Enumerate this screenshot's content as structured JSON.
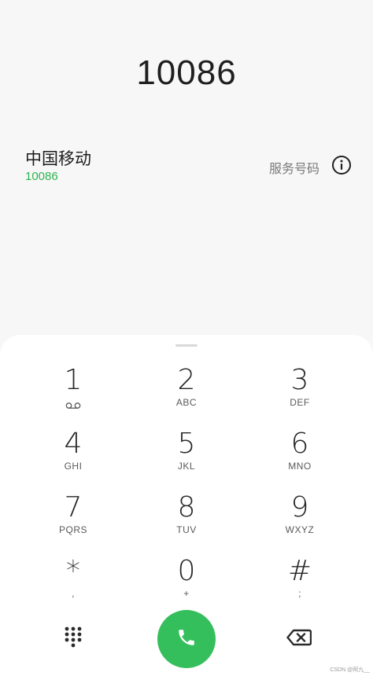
{
  "dialer": {
    "dialed_number": "10086"
  },
  "contact_match": {
    "name": "中国移动",
    "number": "10086",
    "tag": "服务号码",
    "info_icon": "info-circle-icon"
  },
  "keypad": {
    "keys": [
      {
        "digit": "1",
        "letters": "",
        "icon": "voicemail-icon"
      },
      {
        "digit": "2",
        "letters": "ABC"
      },
      {
        "digit": "3",
        "letters": "DEF"
      },
      {
        "digit": "4",
        "letters": "GHI"
      },
      {
        "digit": "5",
        "letters": "JKL"
      },
      {
        "digit": "6",
        "letters": "MNO"
      },
      {
        "digit": "7",
        "letters": "PQRS"
      },
      {
        "digit": "8",
        "letters": "TUV"
      },
      {
        "digit": "9",
        "letters": "WXYZ"
      },
      {
        "digit": "*",
        "letters": ","
      },
      {
        "digit": "0",
        "letters": "+"
      },
      {
        "digit": "#",
        "letters": ";"
      }
    ]
  },
  "actions": {
    "dialpad_icon": "dialpad-grid-icon",
    "call_icon": "phone-icon",
    "backspace_icon": "backspace-icon"
  },
  "colors": {
    "accent_green": "#35bf5c",
    "number_green": "#2eb34f",
    "background": "#f7f7f7",
    "sheet": "#ffffff"
  },
  "watermark": "CSDN @阿九__"
}
